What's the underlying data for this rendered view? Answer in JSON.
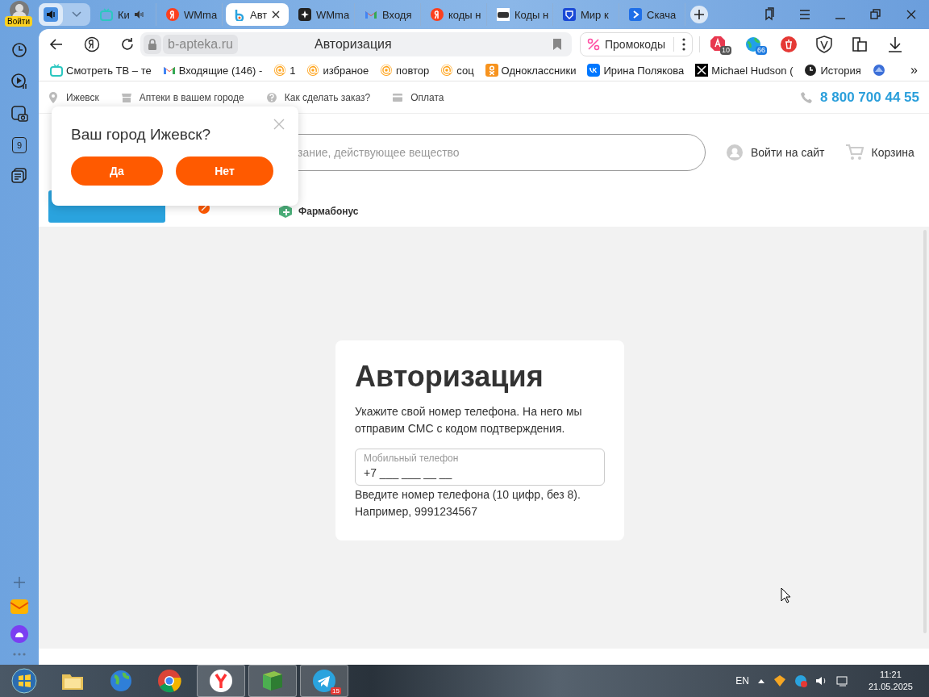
{
  "sidebar": {
    "login_label": "Войти",
    "counter": "9"
  },
  "tabs": [
    {
      "kind": "tv",
      "label": "Ки",
      "audio": true,
      "selected": false
    },
    {
      "kind": "yandex",
      "label": "WMma",
      "audio": false,
      "selected": false
    },
    {
      "kind": "apteka",
      "label": "Авт",
      "audio": false,
      "selected": true
    },
    {
      "kind": "star",
      "label": "WMma",
      "audio": false,
      "selected": false
    },
    {
      "kind": "gmail",
      "label": "Входя",
      "audio": false,
      "selected": false
    },
    {
      "kind": "yandex",
      "label": "коды н",
      "audio": false,
      "selected": false
    },
    {
      "kind": "dark",
      "label": "Коды н",
      "audio": false,
      "selected": false
    },
    {
      "kind": "shield",
      "label": "Мир к",
      "audio": false,
      "selected": false
    },
    {
      "kind": "arrow",
      "label": "Скача",
      "audio": false,
      "selected": false
    }
  ],
  "toolbar": {
    "domain": "b-apteka.ru",
    "page_title": "Авторизация",
    "promo_label": "Промокоды",
    "extensions": [
      {
        "kind": "adblock",
        "badge": "10"
      },
      {
        "kind": "globe",
        "badge": "66"
      },
      {
        "kind": "trash"
      },
      {
        "kind": "shield"
      },
      {
        "kind": "puzzle"
      },
      {
        "kind": "download"
      }
    ]
  },
  "bookmarks": [
    {
      "kind": "tv",
      "label": "Смотреть ТВ – те"
    },
    {
      "kind": "gmail",
      "label": "Входящие (146) -"
    },
    {
      "kind": "at",
      "label": "1"
    },
    {
      "kind": "at",
      "label": "избраное"
    },
    {
      "kind": "at",
      "label": "повтор"
    },
    {
      "kind": "at",
      "label": "соц"
    },
    {
      "kind": "ok",
      "label": "Одноклассники"
    },
    {
      "kind": "vk",
      "label": "Ирина Полякова"
    },
    {
      "kind": "x",
      "label": "Michael Hudson ("
    },
    {
      "kind": "clock",
      "label": "История"
    },
    {
      "kind": "blue"
    }
  ],
  "bookmarks_more": "»",
  "site": {
    "info_links": [
      {
        "kind": "pin",
        "label": "Ижевск"
      },
      {
        "kind": "shop",
        "label": "Аптеки в вашем городе"
      },
      {
        "kind": "help",
        "label": "Как сделать заказ?"
      },
      {
        "kind": "card",
        "label": "Оплата"
      }
    ],
    "phone": "8 800 700 44 55",
    "search_placeholder": "зание, действующее вещество",
    "login_label": "Войти на сайт",
    "cart_label": "Корзина",
    "nav_label": "Фармабонус",
    "city_popup": {
      "question": "Ваш город Ижевск?",
      "yes": "Да",
      "no": "Нет"
    },
    "auth": {
      "title": "Авторизация",
      "text": "Укажите свой номер телефона. На него мы отправим СМС с кодом подтверждения.",
      "field_label": "Мобильный телефон",
      "field_value": "+7 ___ ___ __ __",
      "hint": [
        "Введите номер телефона (10 цифр, без 8).",
        "Например, 9991234567"
      ]
    }
  },
  "taskbar": {
    "language": "EN",
    "telegram_badge": "15",
    "time": "11:21",
    "date": "21.05.2025"
  }
}
